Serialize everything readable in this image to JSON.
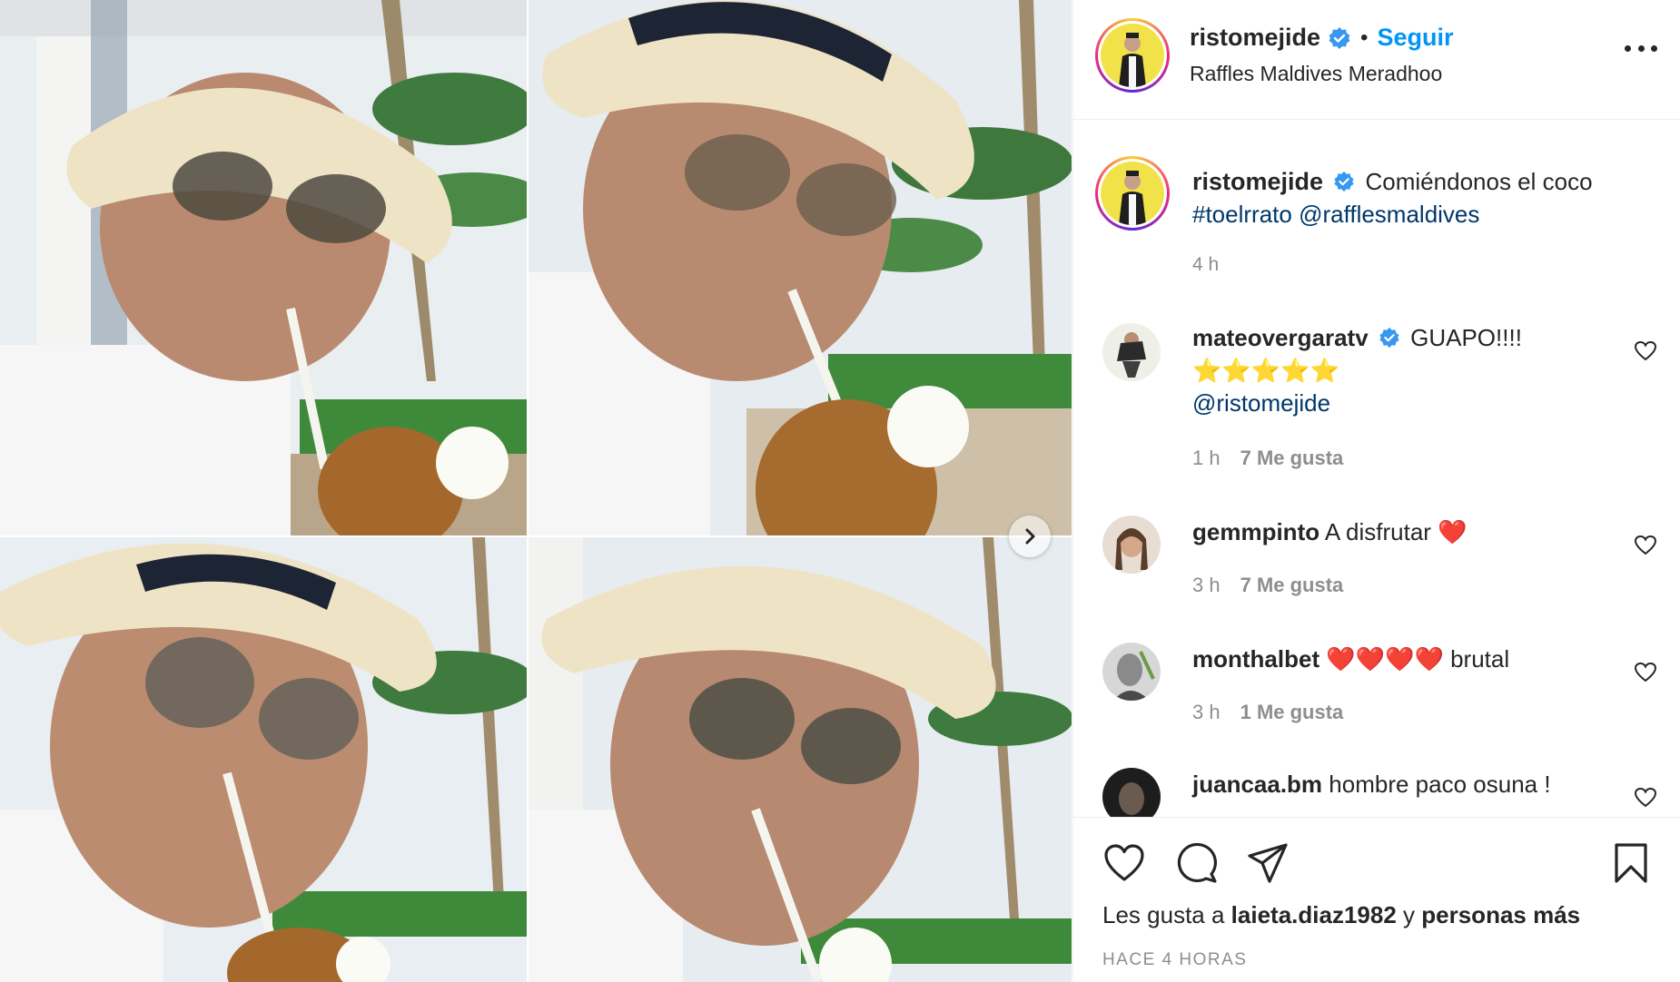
{
  "post": {
    "author": "ristomejide",
    "verified": true,
    "dot": "•",
    "follow_label": "Seguir",
    "location": "Raffles Maldives Meradhoo",
    "more_icon": "more-options-icon"
  },
  "caption": {
    "username": "ristomejide",
    "text": "Comiéndonos el coco",
    "hashtag": "#toelrrato",
    "mention": "@rafflesmaldives",
    "time": "4 h"
  },
  "comments": [
    {
      "username": "mateovergaratv",
      "verified": true,
      "text": "GUAPO!!!!",
      "emoji": "⭐⭐⭐⭐⭐",
      "mention": "@ristomejide",
      "time": "1 h",
      "likes": "7 Me gusta"
    },
    {
      "username": "gemmpinto",
      "verified": false,
      "text": "A disfrutar",
      "emoji": "❤️",
      "time": "3 h",
      "likes": "7 Me gusta"
    },
    {
      "username": "monthalbet",
      "verified": false,
      "emoji": "❤️❤️❤️❤️",
      "text": "brutal",
      "time": "3 h",
      "likes": "1 Me gusta"
    },
    {
      "username": "juancaa.bm",
      "verified": false,
      "text": "hombre paco osuna !"
    }
  ],
  "actions": {
    "likes_prefix": "Les gusta a",
    "liked_by": "laieta.diaz1982",
    "likes_joiner": "y",
    "likes_suffix": "personas más",
    "timestamp": "HACE 4 HORAS"
  },
  "colors": {
    "accent": "#0095f6",
    "link": "#00376b",
    "verified": "#3897f0",
    "muted": "#8e8e8e"
  }
}
